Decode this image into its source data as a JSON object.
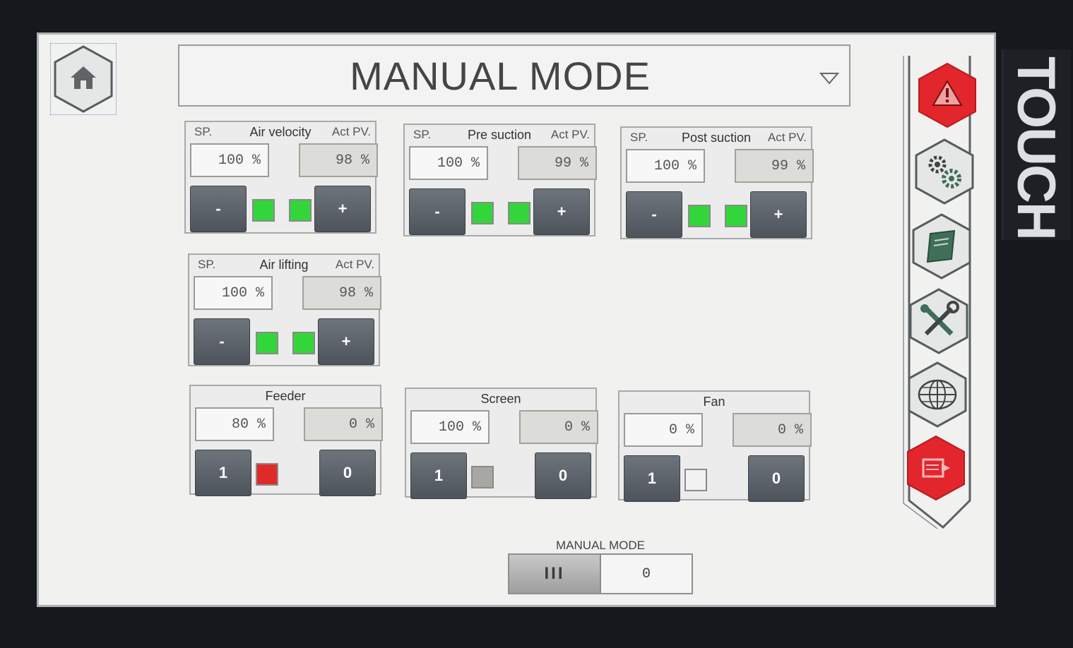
{
  "header": {
    "title": "MANUAL MODE"
  },
  "brand": {
    "text": "TOUCH"
  },
  "analog_panels": [
    {
      "name": "Air velocity",
      "sp_label": "SP.",
      "pv_label": "Act PV.",
      "sp": "100 %",
      "pv": "98 %",
      "minus": "-",
      "plus": "+",
      "indicator_colors": [
        "#33d63a",
        "#33d63a"
      ]
    },
    {
      "name": "Pre suction",
      "sp_label": "SP.",
      "pv_label": "Act PV.",
      "sp": "100 %",
      "pv": "99 %",
      "minus": "-",
      "plus": "+",
      "indicator_colors": [
        "#33d63a",
        "#33d63a"
      ]
    },
    {
      "name": "Post suction",
      "sp_label": "SP.",
      "pv_label": "Act PV.",
      "sp": "100 %",
      "pv": "99 %",
      "minus": "-",
      "plus": "+",
      "indicator_colors": [
        "#33d63a",
        "#33d63a"
      ]
    },
    {
      "name": "Air lifting",
      "sp_label": "SP.",
      "pv_label": "Act PV.",
      "sp": "100 %",
      "pv": "98 %",
      "minus": "-",
      "plus": "+",
      "indicator_colors": [
        "#33d63a",
        "#33d63a"
      ]
    }
  ],
  "onoff_panels": [
    {
      "name": "Feeder",
      "sp": "80 %",
      "pv": "0 %",
      "on": "1",
      "off": "0",
      "indicator_color": "#e02a2a"
    },
    {
      "name": "Screen",
      "sp": "100 %",
      "pv": "0 %",
      "on": "1",
      "off": "0",
      "indicator_color": "#a7a8a2"
    },
    {
      "name": "Fan",
      "sp": "0 %",
      "pv": "0 %",
      "on": "1",
      "off": "0",
      "indicator_color": "#f2f2f2"
    }
  ],
  "manual_mode_switch": {
    "label": "MANUAL MODE",
    "left": "III",
    "right": "0"
  },
  "nav_icons": [
    "alarm-icon",
    "settings-gears-icon",
    "manual-book-icon",
    "tools-icon",
    "globe-icon",
    "exit-icon"
  ],
  "colors": {
    "alarm_red": "#e3262b",
    "hex_fill": "#e4e7e5",
    "hex_border": "#555d5f",
    "icon_green": "#3f6e59"
  }
}
